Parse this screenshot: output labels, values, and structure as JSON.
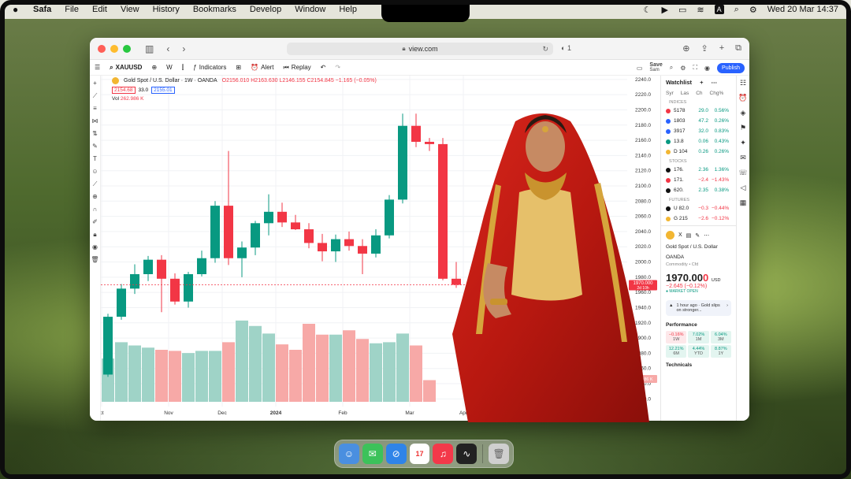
{
  "menubar": {
    "app_name": "Safa",
    "items": [
      "File",
      "Edit",
      "View",
      "History",
      "Bookmarks",
      "Develop",
      "Window",
      "Help"
    ],
    "clock": "Wed 20 Mar  14:37",
    "input_badge": "A"
  },
  "browser": {
    "url": "view.com",
    "tab_count": "1"
  },
  "toolbar": {
    "symbol": "XAUUSD",
    "interval": "W",
    "indicators_label": "Indicators",
    "alert_label": "Alert",
    "replay_label": "Replay",
    "save_label": "Save",
    "save_sub": "Sam",
    "publish_label": "Publish"
  },
  "legend": {
    "instrument": "Gold Spot / U.S. Dollar · 1W · OANDA",
    "ohlc": "O2156.010  H2163.630  L2146.155  C2154.845  −1.165 (−0.05%)",
    "sell_price": "2154.68",
    "spread": "33.0",
    "buy_price": "2155.01",
    "vol_label": "Vol",
    "vol_value": "262.986 K"
  },
  "chart_data": {
    "type": "candlestick",
    "x_labels": [
      "ct",
      "Nov",
      "Dec",
      "2024",
      "Feb",
      "Mar",
      "Apr"
    ],
    "y_ticks": [
      2240,
      2220,
      2200,
      2180,
      2160,
      2140,
      2120,
      2100,
      2080,
      2060,
      2040,
      2020,
      2000,
      1980,
      1960,
      1940,
      1920,
      1900,
      1880,
      1860,
      1840,
      1820
    ],
    "ylim": [
      1810,
      2245
    ],
    "last_price_label": "1970.000",
    "last_price_sub": "2d 10h",
    "vol_price_label": "262.986 K",
    "candles": [
      {
        "o": 1852,
        "c": 1928,
        "h": 1932,
        "l": 1849
      },
      {
        "o": 1928,
        "c": 1965,
        "h": 1971,
        "l": 1924
      },
      {
        "o": 1965,
        "c": 1984,
        "h": 1997,
        "l": 1958
      },
      {
        "o": 1984,
        "c": 2003,
        "h": 2008,
        "l": 1975
      },
      {
        "o": 2003,
        "c": 1978,
        "h": 2009,
        "l": 1934
      },
      {
        "o": 1978,
        "c": 1948,
        "h": 1985,
        "l": 1944
      },
      {
        "o": 1948,
        "c": 1984,
        "h": 1987,
        "l": 1940
      },
      {
        "o": 1984,
        "c": 2005,
        "h": 2015,
        "l": 1981
      },
      {
        "o": 2005,
        "c": 2074,
        "h": 2080,
        "l": 1999
      },
      {
        "o": 2074,
        "c": 2005,
        "h": 2146,
        "l": 1996
      },
      {
        "o": 2005,
        "c": 2019,
        "h": 2027,
        "l": 1980
      },
      {
        "o": 2019,
        "c": 2051,
        "h": 2054,
        "l": 2009
      },
      {
        "o": 2051,
        "c": 2066,
        "h": 2089,
        "l": 2035
      },
      {
        "o": 2066,
        "c": 2052,
        "h": 2078,
        "l": 2046
      },
      {
        "o": 2052,
        "c": 2043,
        "h": 2062,
        "l": 2042
      },
      {
        "o": 2043,
        "c": 2025,
        "h": 2051,
        "l": 2018
      },
      {
        "o": 2025,
        "c": 2014,
        "h": 2037,
        "l": 2001
      },
      {
        "o": 2014,
        "c": 2030,
        "h": 2036,
        "l": 2000
      },
      {
        "o": 2030,
        "c": 2021,
        "h": 2040,
        "l": 2015
      },
      {
        "o": 2021,
        "c": 2011,
        "h": 2030,
        "l": 1984
      },
      {
        "o": 2011,
        "c": 2035,
        "h": 2043,
        "l": 2006
      },
      {
        "o": 2035,
        "c": 2082,
        "h": 2088,
        "l": 2031
      },
      {
        "o": 2082,
        "c": 2179,
        "h": 2195,
        "l": 2077
      },
      {
        "o": 2179,
        "c": 2158,
        "h": 2195,
        "l": 2151
      },
      {
        "o": 2158,
        "c": 2155,
        "h": 2163,
        "l": 2146
      },
      {
        "o": 2155,
        "c": 1978,
        "h": 2163,
        "l": 1976
      },
      {
        "o": 1978,
        "c": 1970,
        "h": 2000,
        "l": 1966
      }
    ],
    "volumes": [
      40,
      55,
      52,
      50,
      48,
      47,
      45,
      47,
      47,
      55,
      75,
      70,
      63,
      53,
      48,
      72,
      62,
      62,
      66,
      58,
      54,
      55,
      63,
      52,
      20
    ]
  },
  "watchlist": {
    "title": "Watchlist",
    "columns": [
      "Syr",
      "Las",
      "Ch",
      "Chg%"
    ],
    "sections": [
      {
        "name": "INDICES",
        "rows": [
          {
            "n": "5178",
            "c": "29.0",
            "p": "0.56%",
            "dir": "up",
            "color": "#f23645"
          },
          {
            "n": "1803",
            "c": "47.2",
            "p": "0.26%",
            "dir": "up",
            "color": "#2962ff"
          },
          {
            "n": "3917",
            "c": "32.0",
            "p": "0.83%",
            "dir": "up",
            "color": "#2962ff"
          },
          {
            "n": "13.8",
            "c": "0.06",
            "p": "0.43%",
            "dir": "up",
            "color": "#089981"
          },
          {
            "n": "D 104",
            "c": "0.26",
            "p": "0.26%",
            "dir": "mix",
            "color": "#f2b632"
          }
        ]
      },
      {
        "name": "STOCKS",
        "rows": [
          {
            "n": "176.",
            "c": "2.36",
            "p": "1.36%",
            "dir": "up",
            "color": "#111111"
          },
          {
            "n": "171.",
            "c": "−2.4",
            "p": "−1.43%",
            "dir": "dn",
            "color": "#f23645"
          },
          {
            "n": "620.",
            "c": "2.35",
            "p": "0.38%",
            "dir": "up",
            "color": "#111111"
          }
        ]
      },
      {
        "name": "FUTURES",
        "rows": [
          {
            "n": "U 82.0",
            "c": "−0.3",
            "p": "−0.44%",
            "dir": "dn",
            "color": "#111111"
          },
          {
            "n": "G 215",
            "c": "−2.6",
            "p": "−0.12%",
            "dir": "dn",
            "color": "#f2b632"
          }
        ]
      }
    ]
  },
  "detail": {
    "symbol_short": "X",
    "name": "Gold Spot / U.S. Dollar",
    "exchange": "OANDA",
    "category": "Commodity • Cfd",
    "price_main": "1970.00",
    "price_last": "0",
    "currency": "USD",
    "change": "−2.645 (−0.12%)",
    "market_status": "● MARKET OPEN",
    "news": "1 hour ago · Gold slips on stronger...",
    "performance_title": "Performance",
    "performance": [
      {
        "v": "−0.16%",
        "l": "1W",
        "t": "r"
      },
      {
        "v": "7.02%",
        "l": "1M",
        "t": "g"
      },
      {
        "v": "6.04%",
        "l": "3M",
        "t": "g"
      },
      {
        "v": "12.21%",
        "l": "6M",
        "t": "g"
      },
      {
        "v": "4.44%",
        "l": "YTD",
        "t": "g"
      },
      {
        "v": "8.87%",
        "l": "1Y",
        "t": "g"
      }
    ],
    "technicals_title": "Technicals"
  }
}
